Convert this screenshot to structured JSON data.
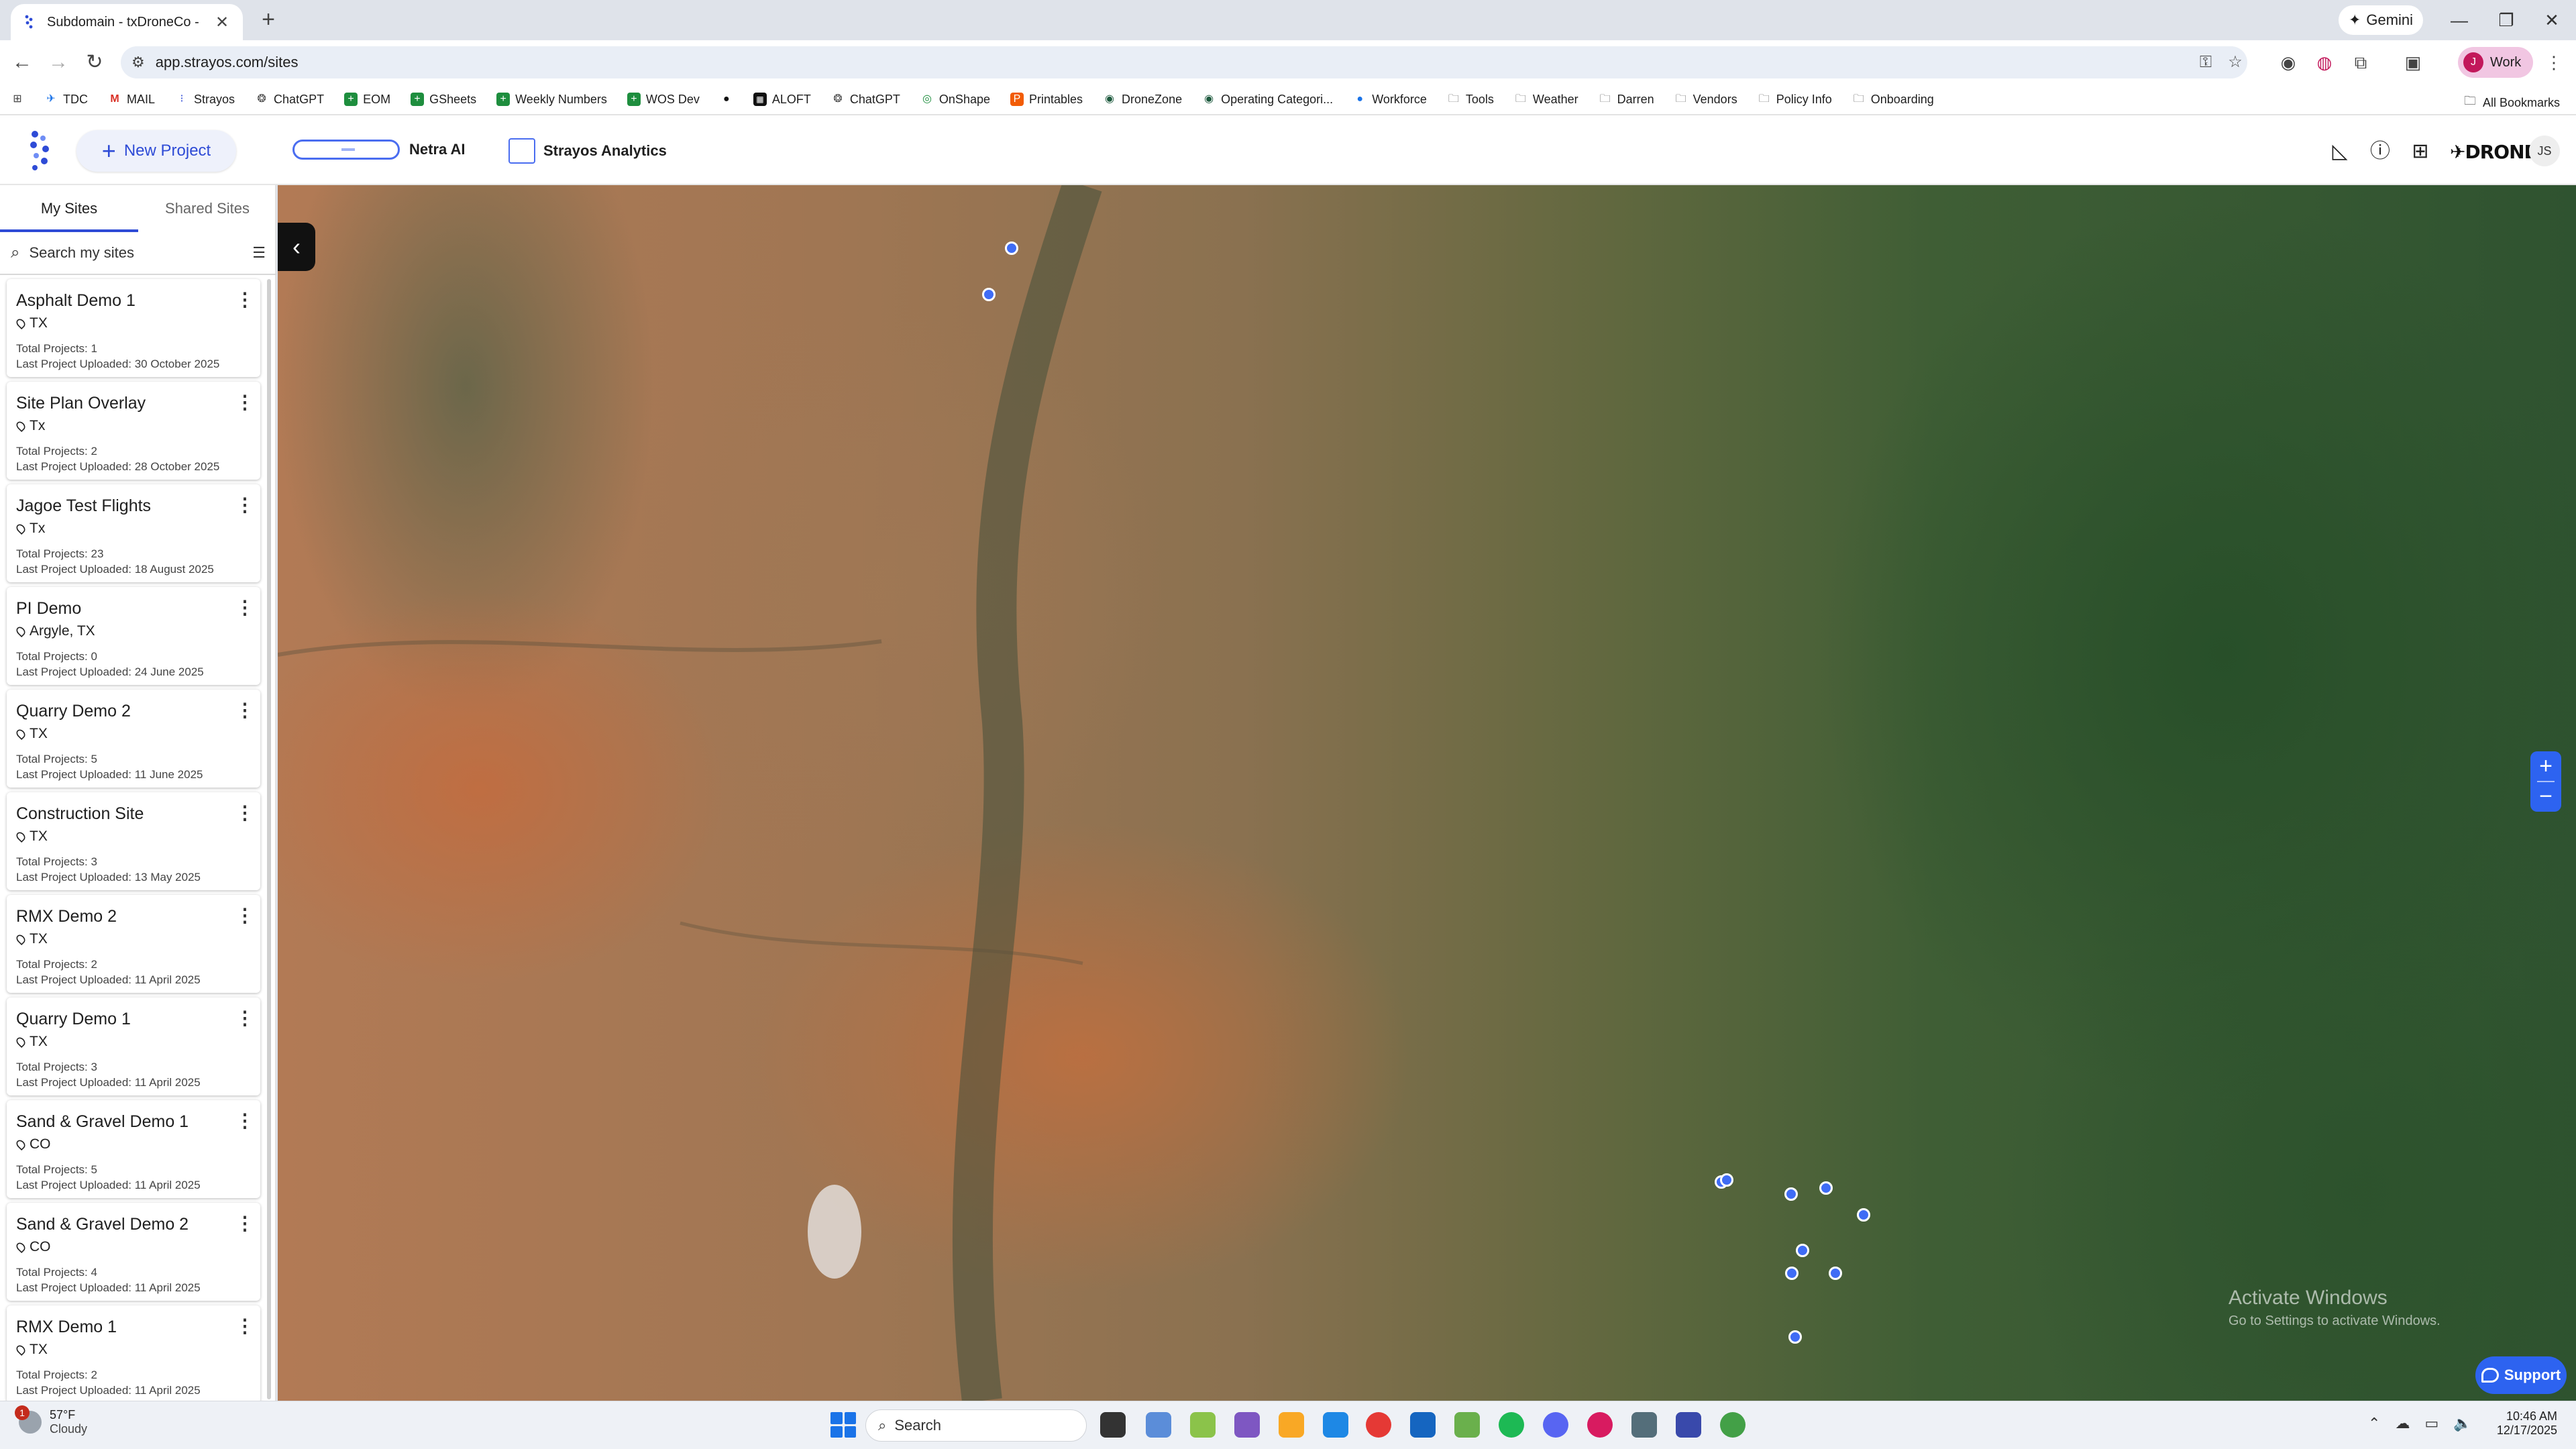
{
  "browser": {
    "tab_title": "Subdomain - txDroneCo - Dem",
    "tab_close": "✕",
    "new_tab": "+",
    "gemini_label": "Gemini",
    "url": "app.strayos.com/sites",
    "profile_label": "Work",
    "profile_initial": "J",
    "win_minimize": "—",
    "win_restore": "❐",
    "win_close": "✕",
    "bookmarks": [
      "TDC",
      "MAIL",
      "Strayos",
      "ChatGPT",
      "EOM",
      "GSheets",
      "Weekly Numbers",
      "WOS Dev",
      "",
      "ALOFT",
      "ChatGPT",
      "OnShape",
      "Printables",
      "DroneZone",
      "Operating Categori...",
      "Workforce",
      "Tools",
      "Weather",
      "Darren",
      "Vendors",
      "Policy Info",
      "Onboarding"
    ],
    "all_bookmarks": "All Bookmarks"
  },
  "app": {
    "new_project_label": "New Project",
    "netra_label": "Netra AI",
    "analytics_label": "Strayos Analytics",
    "drone_logo": "DRONE",
    "user_initials": "JS"
  },
  "sidebar": {
    "tabs": [
      "My Sites",
      "Shared Sites"
    ],
    "search_placeholder": "Search my sites",
    "sites": [
      {
        "name": "Asphalt Demo 1",
        "location": "TX",
        "total": "Total Projects: 1",
        "last": "Last Project Uploaded: 30 October 2025"
      },
      {
        "name": "Site Plan Overlay",
        "location": "Tx",
        "total": "Total Projects: 2",
        "last": "Last Project Uploaded: 28 October 2025"
      },
      {
        "name": "Jagoe Test Flights",
        "location": "Tx",
        "total": "Total Projects: 23",
        "last": "Last Project Uploaded: 18 August 2025"
      },
      {
        "name": "PI Demo",
        "location": "Argyle, TX",
        "total": "Total Projects: 0",
        "last": "Last Project Uploaded: 24 June 2025"
      },
      {
        "name": "Quarry Demo 2",
        "location": "TX",
        "total": "Total Projects: 5",
        "last": "Last Project Uploaded: 11 June 2025"
      },
      {
        "name": "Construction Site",
        "location": "TX",
        "total": "Total Projects: 3",
        "last": "Last Project Uploaded: 13 May 2025"
      },
      {
        "name": "RMX Demo 2",
        "location": "TX",
        "total": "Total Projects: 2",
        "last": "Last Project Uploaded: 11 April 2025"
      },
      {
        "name": "Quarry Demo 1",
        "location": "TX",
        "total": "Total Projects: 3",
        "last": "Last Project Uploaded: 11 April 2025"
      },
      {
        "name": "Sand & Gravel Demo 1",
        "location": "CO",
        "total": "Total Projects: 5",
        "last": "Last Project Uploaded: 11 April 2025"
      },
      {
        "name": "Sand & Gravel Demo 2",
        "location": "CO",
        "total": "Total Projects: 4",
        "last": "Last Project Uploaded: 11 April 2025"
      },
      {
        "name": "RMX Demo 1",
        "location": "TX",
        "total": "Total Projects: 2",
        "last": "Last Project Uploaded: 11 April 2025"
      }
    ]
  },
  "map": {
    "point_color": "#3f6cf5",
    "zoom_in": "+",
    "zoom_out": "−",
    "collapse_icon": "‹",
    "activate_title": "Activate Windows",
    "activate_sub": "Go to Settings to activate Windows.",
    "support_label": "Support"
  },
  "taskbar": {
    "weather_temp": "57°F",
    "weather_cond": "Cloudy",
    "weather_badge": "1",
    "search_label": "Search",
    "time": "10:46 AM",
    "date": "12/17/2025"
  },
  "colors": {
    "accent": "#2e4bd6",
    "map_button": "#2d63f0"
  }
}
